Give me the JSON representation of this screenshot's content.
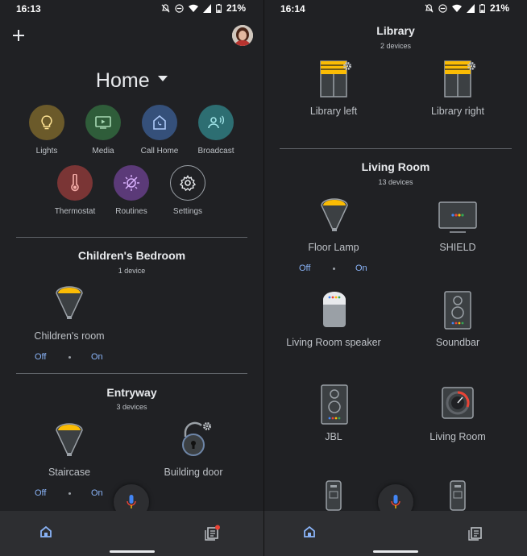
{
  "left": {
    "status": {
      "time": "16:13",
      "battery": "21%"
    },
    "home_title": "Home",
    "shortcuts": [
      {
        "label": "Lights",
        "icon": "lightbulb-icon",
        "color": "#6b5a2a"
      },
      {
        "label": "Media",
        "icon": "media-icon",
        "color": "#2f5d3a"
      },
      {
        "label": "Call Home",
        "icon": "call-home-icon",
        "color": "#35507a"
      },
      {
        "label": "Broadcast",
        "icon": "broadcast-icon",
        "color": "#2d6e72"
      },
      {
        "label": "Thermostat",
        "icon": "thermostat-icon",
        "color": "#7a3535"
      },
      {
        "label": "Routines",
        "icon": "routines-icon",
        "color": "#5b3a78"
      },
      {
        "label": "Settings",
        "icon": "gear-icon",
        "color": "#202124"
      }
    ],
    "rooms": [
      {
        "title": "Children's Bedroom",
        "subtitle": "1 device",
        "devices": [
          {
            "label": "Children's room",
            "off": "Off",
            "on": "On"
          }
        ]
      },
      {
        "title": "Entryway",
        "subtitle": "3 devices",
        "devices": [
          {
            "label": "Staircase",
            "off": "Off",
            "on": "On"
          },
          {
            "label": "Building door"
          }
        ]
      }
    ]
  },
  "right": {
    "status": {
      "time": "16:14",
      "battery": "21%"
    },
    "rooms": [
      {
        "title": "Library",
        "subtitle": "2 devices",
        "devices": [
          {
            "label": "Library left"
          },
          {
            "label": "Library right"
          }
        ]
      },
      {
        "title": "Living Room",
        "subtitle": "13 devices",
        "devices": [
          {
            "label": "Floor Lamp",
            "off": "Off",
            "on": "On"
          },
          {
            "label": "SHIELD"
          },
          {
            "label": "Living Room speaker"
          },
          {
            "label": "Soundbar"
          },
          {
            "label": "JBL"
          },
          {
            "label": "Living Room"
          }
        ]
      }
    ]
  },
  "colors": {
    "background": "#202124",
    "nav": "#2d2e31",
    "accent_blue": "#8ab4f8",
    "lamp_yellow": "#fbbc04"
  }
}
